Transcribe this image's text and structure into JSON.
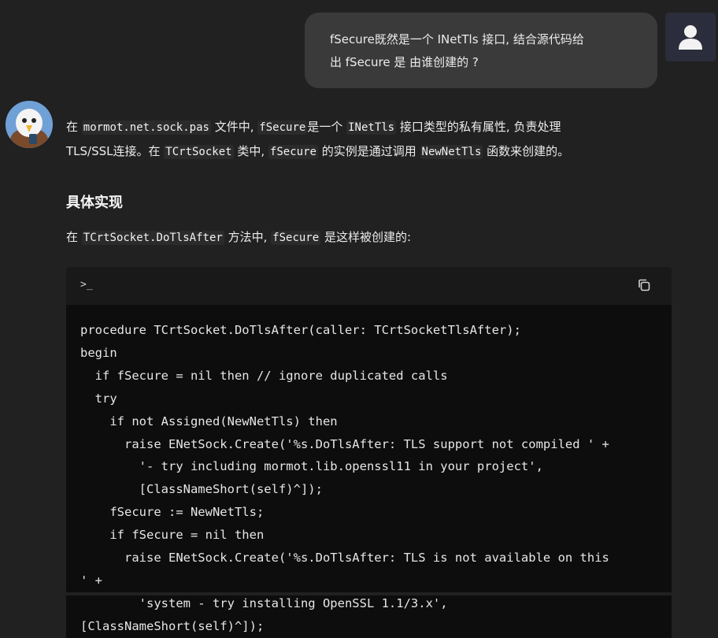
{
  "user_message": {
    "line1": "fSecure既然是一个 INetTls 接口, 结合源代码给",
    "line2": "出 fSecure 是 由谁创建的 ?"
  },
  "assistant": {
    "p1_a": "在",
    "p1_code1": "mormot.net.sock.pas",
    "p1_b": "文件中,",
    "p1_code2": "fSecure",
    "p1_c": "是一个",
    "p1_code3": "INetTls",
    "p1_d": "接口类型的私有属性, 负责处理",
    "p1_e": "TLS/SSL连接。在",
    "p1_code4": "TCrtSocket",
    "p1_f": "类中,",
    "p1_code5": "fSecure",
    "p1_g": "的实例是通过调用",
    "p1_code6": "NewNetTls",
    "p1_h": "函数来创建的。",
    "heading": "具体实现",
    "p2_a": "在",
    "p2_code1": "TCrtSocket.DoTlsAfter",
    "p2_b": "方法中,",
    "p2_code2": "fSecure",
    "p2_c": "是这样被创建的:"
  },
  "code_block": {
    "header_icon": ">_",
    "lines": [
      "procedure TCrtSocket.DoTlsAfter(caller: TCrtSocketTlsAfter);",
      "begin",
      "  if fSecure = nil then // ignore duplicated calls",
      "  try",
      "    if not Assigned(NewNetTls) then",
      "      raise ENetSock.Create('%s.DoTlsAfter: TLS support not compiled ' +",
      "        '- try including mormot.lib.openssl11 in your project',",
      "        [ClassNameShort(self)^]);",
      "    fSecure := NewNetTls;",
      "    if fSecure = nil then",
      "      raise ENetSock.Create('%s.DoTlsAfter: TLS is not available on this",
      "' +",
      "        'system - try installing OpenSSL 1.1/3.x',",
      "[ClassNameShort(self)^]);"
    ]
  },
  "icons": {
    "user_avatar": "user-icon",
    "assistant_avatar": "eagle-avatar-icon",
    "terminal": "terminal-icon",
    "copy": "copy-icon"
  }
}
